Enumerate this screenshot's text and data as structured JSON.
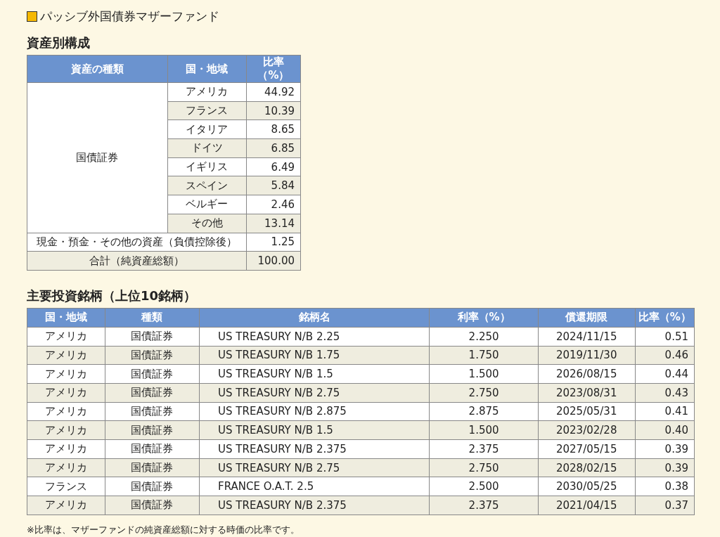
{
  "title": "パッシブ外国債券マザーファンド",
  "composition": {
    "heading": "資産別構成",
    "columns": [
      "資産の種類",
      "国・地域",
      "比率（%）"
    ],
    "groups": [
      {
        "type": "国債証券",
        "rows": [
          {
            "region": "アメリカ",
            "ratio": "44.92"
          },
          {
            "region": "フランス",
            "ratio": "10.39"
          },
          {
            "region": "イタリア",
            "ratio": "8.65"
          },
          {
            "region": "ドイツ",
            "ratio": "6.85"
          },
          {
            "region": "イギリス",
            "ratio": "6.49"
          },
          {
            "region": "スペイン",
            "ratio": "5.84"
          },
          {
            "region": "ベルギー",
            "ratio": "2.46"
          },
          {
            "region": "その他",
            "ratio": "13.14"
          }
        ]
      }
    ],
    "others": [
      {
        "label": "現金・預金・その他の資産（負債控除後）",
        "ratio": "1.25"
      }
    ],
    "total": {
      "label": "合計（純資産総額）",
      "ratio": "100.00"
    }
  },
  "holdings": {
    "heading": "主要投資銘柄（上位10銘柄）",
    "columns": [
      "国・地域",
      "種類",
      "銘柄名",
      "利率（%）",
      "償還期限",
      "比率（%）"
    ],
    "rows": [
      [
        "アメリカ",
        "国債証券",
        "US TREASURY N/B 2.25",
        "2.250",
        "2024/11/15",
        "0.51"
      ],
      [
        "アメリカ",
        "国債証券",
        "US TREASURY N/B 1.75",
        "1.750",
        "2019/11/30",
        "0.46"
      ],
      [
        "アメリカ",
        "国債証券",
        "US TREASURY N/B 1.5",
        "1.500",
        "2026/08/15",
        "0.44"
      ],
      [
        "アメリカ",
        "国債証券",
        "US TREASURY N/B 2.75",
        "2.750",
        "2023/08/31",
        "0.43"
      ],
      [
        "アメリカ",
        "国債証券",
        "US TREASURY N/B 2.875",
        "2.875",
        "2025/05/31",
        "0.41"
      ],
      [
        "アメリカ",
        "国債証券",
        "US TREASURY N/B 1.5",
        "1.500",
        "2023/02/28",
        "0.40"
      ],
      [
        "アメリカ",
        "国債証券",
        "US TREASURY N/B 2.375",
        "2.375",
        "2027/05/15",
        "0.39"
      ],
      [
        "アメリカ",
        "国債証券",
        "US TREASURY N/B 2.75",
        "2.750",
        "2028/02/15",
        "0.39"
      ],
      [
        "フランス",
        "国債証券",
        "FRANCE O.A.T. 2.5",
        "2.500",
        "2030/05/25",
        "0.38"
      ],
      [
        "アメリカ",
        "国債証券",
        "US TREASURY N/B 2.375",
        "2.375",
        "2021/04/15",
        "0.37"
      ]
    ]
  },
  "footnote": "※比率は、マザーファンドの純資産総額に対する時価の比率です。"
}
